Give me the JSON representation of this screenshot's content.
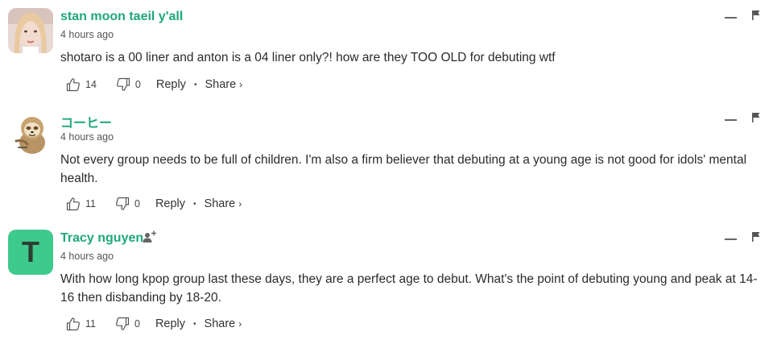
{
  "comments": [
    {
      "author": "stan moon taeil y'all",
      "time": "4 hours ago",
      "text": "shotaro is a 00 liner and anton is a 04 liner only?! how are they TOO OLD for debuting wtf",
      "likes": "14",
      "dislikes": "0",
      "reply_label": "Reply",
      "share_label": "Share",
      "avatar": "photo-avatar"
    },
    {
      "author": "コーヒー",
      "time": "4 hours ago",
      "text": "Not every group needs to be full of children. I'm also a firm believer that debuting at a young age is not good for idols' mental health.",
      "likes": "11",
      "dislikes": "0",
      "reply_label": "Reply",
      "share_label": "Share",
      "avatar": "sloth-avatar"
    },
    {
      "author": "Tracy nguyen",
      "time": "4 hours ago",
      "text": "With how long kpop group last these days, they are a perfect age to debut. What's the point of debuting young and peak at 14-16 then disbanding by 18-20.",
      "likes": "11",
      "dislikes": "0",
      "reply_label": "Reply",
      "share_label": "Share",
      "avatar_letter": "T",
      "avatar_color": "#3ec98d"
    }
  ],
  "icons": {
    "like": "thumbs-up-icon",
    "dislike": "thumbs-down-icon",
    "collapse": "minus-icon",
    "flag": "flag-icon",
    "follow": "add-user-icon",
    "share_chevron": "›",
    "separator": "•"
  },
  "colors": {
    "author": "#1fa77a",
    "letter_avatar": "#3ec98d"
  }
}
